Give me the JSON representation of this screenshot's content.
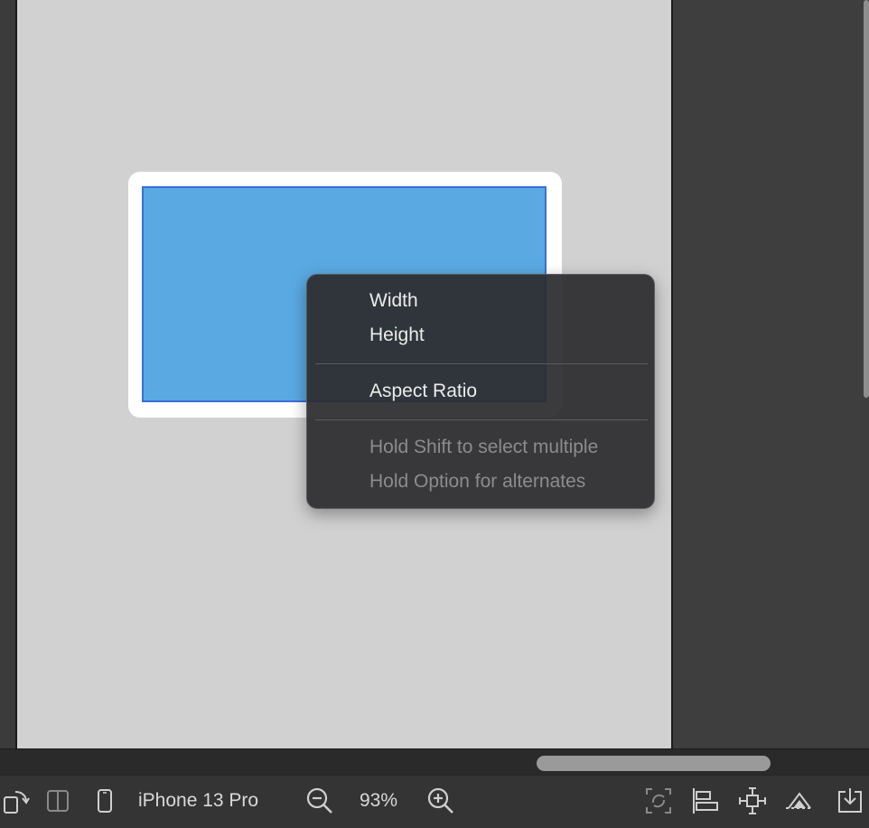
{
  "context_menu": {
    "items": [
      {
        "label": "Width",
        "enabled": true
      },
      {
        "label": "Height",
        "enabled": true
      },
      {
        "label": "Aspect Ratio",
        "enabled": true
      },
      {
        "label": "Hold Shift to select multiple",
        "enabled": false
      },
      {
        "label": "Hold Option for alternates",
        "enabled": false
      }
    ]
  },
  "toolbar": {
    "device_name": "iPhone 13 Pro",
    "zoom_level": "93%",
    "icons": [
      "rotate-orientation-icon",
      "split-view-icon",
      "device-icon",
      "zoom-out-icon",
      "zoom-in-icon",
      "update-frames-icon",
      "align-icon",
      "add-constraints-icon",
      "resolve-issues-icon",
      "embed-in-icon"
    ]
  },
  "colors": {
    "canvas": "#d1d1d1",
    "view_fill": "#5aa9e2",
    "selection_border": "#3a6fd8",
    "menu_bg": "#2c2c2e"
  }
}
